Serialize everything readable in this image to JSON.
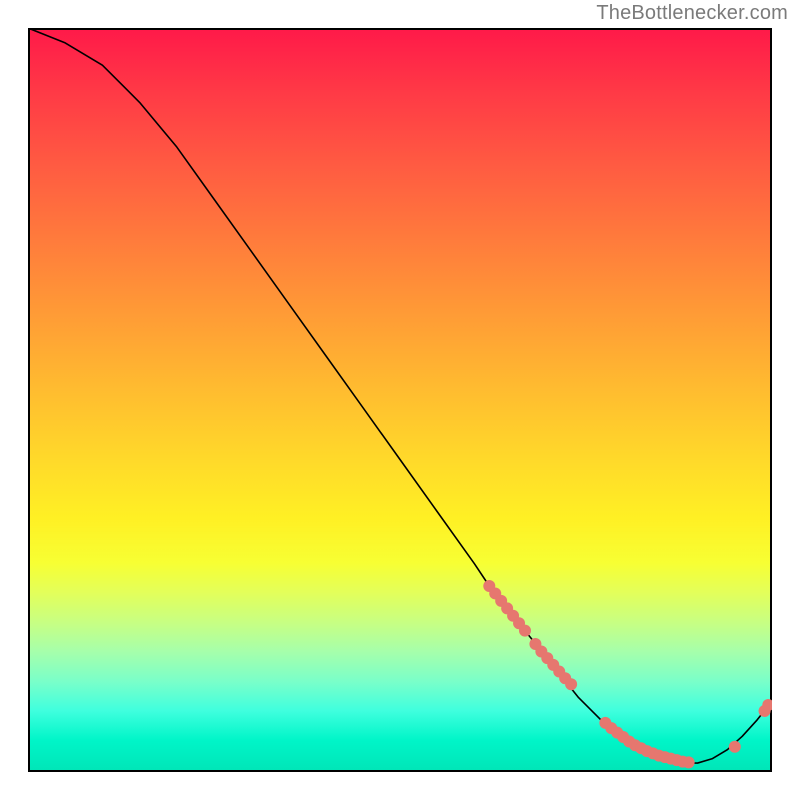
{
  "attribution": "TheBottlenecker.com",
  "chart_data": {
    "type": "line",
    "title": "",
    "xlabel": "",
    "ylabel": "",
    "xlim": [
      0,
      100
    ],
    "ylim": [
      0,
      100
    ],
    "grid": false,
    "legend": false,
    "series": [
      {
        "name": "curve",
        "style": "solid",
        "color": "#000000",
        "x": [
          0,
          5,
          10,
          15,
          20,
          25,
          30,
          35,
          40,
          45,
          50,
          55,
          60,
          62,
          64,
          66,
          68,
          70,
          72,
          74,
          76,
          78,
          80,
          82,
          84,
          86,
          88,
          90,
          92,
          94,
          96,
          98,
          100
        ],
        "y": [
          100,
          98,
          95,
          90,
          84,
          77,
          70,
          63,
          56,
          49,
          42,
          35,
          28,
          25,
          22.5,
          20,
          17.5,
          15,
          12.5,
          10,
          8,
          6,
          4.5,
          3.2,
          2.2,
          1.5,
          1.2,
          1.2,
          1.8,
          3,
          4.8,
          7,
          9.5
        ]
      },
      {
        "name": "markers",
        "style": "scatter",
        "color": "#e6776f",
        "x": [
          62,
          62.8,
          63.6,
          64.4,
          65.2,
          66,
          66.8,
          68.2,
          69,
          69.8,
          70.6,
          71.4,
          72.2,
          73,
          77.6,
          78.4,
          79.2,
          80,
          80.8,
          81.6,
          82.4,
          83.2,
          84,
          84.8,
          85.6,
          86.4,
          87.2,
          88,
          88.8,
          95,
          99,
          99.5
        ],
        "y": [
          25,
          24,
          23,
          22,
          21,
          20,
          19,
          17.2,
          16.2,
          15.3,
          14.4,
          13.5,
          12.6,
          11.8,
          6.6,
          5.9,
          5.3,
          4.7,
          4.1,
          3.6,
          3.2,
          2.8,
          2.5,
          2.2,
          2.0,
          1.8,
          1.6,
          1.4,
          1.3,
          3.4,
          8.2,
          9.0
        ]
      }
    ]
  }
}
